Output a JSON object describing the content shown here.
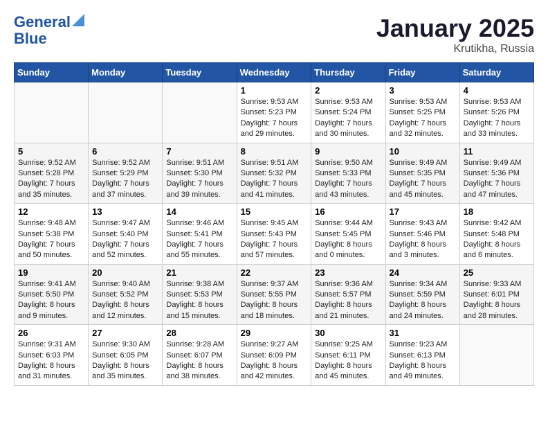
{
  "logo": {
    "line1": "General",
    "line2": "Blue"
  },
  "title": "January 2025",
  "location": "Krutikha, Russia",
  "days_header": [
    "Sunday",
    "Monday",
    "Tuesday",
    "Wednesday",
    "Thursday",
    "Friday",
    "Saturday"
  ],
  "weeks": [
    [
      {
        "day": "",
        "sunrise": "",
        "sunset": "",
        "daylight": ""
      },
      {
        "day": "",
        "sunrise": "",
        "sunset": "",
        "daylight": ""
      },
      {
        "day": "",
        "sunrise": "",
        "sunset": "",
        "daylight": ""
      },
      {
        "day": "1",
        "sunrise": "Sunrise: 9:53 AM",
        "sunset": "Sunset: 5:23 PM",
        "daylight": "Daylight: 7 hours and 29 minutes."
      },
      {
        "day": "2",
        "sunrise": "Sunrise: 9:53 AM",
        "sunset": "Sunset: 5:24 PM",
        "daylight": "Daylight: 7 hours and 30 minutes."
      },
      {
        "day": "3",
        "sunrise": "Sunrise: 9:53 AM",
        "sunset": "Sunset: 5:25 PM",
        "daylight": "Daylight: 7 hours and 32 minutes."
      },
      {
        "day": "4",
        "sunrise": "Sunrise: 9:53 AM",
        "sunset": "Sunset: 5:26 PM",
        "daylight": "Daylight: 7 hours and 33 minutes."
      }
    ],
    [
      {
        "day": "5",
        "sunrise": "Sunrise: 9:52 AM",
        "sunset": "Sunset: 5:28 PM",
        "daylight": "Daylight: 7 hours and 35 minutes."
      },
      {
        "day": "6",
        "sunrise": "Sunrise: 9:52 AM",
        "sunset": "Sunset: 5:29 PM",
        "daylight": "Daylight: 7 hours and 37 minutes."
      },
      {
        "day": "7",
        "sunrise": "Sunrise: 9:51 AM",
        "sunset": "Sunset: 5:30 PM",
        "daylight": "Daylight: 7 hours and 39 minutes."
      },
      {
        "day": "8",
        "sunrise": "Sunrise: 9:51 AM",
        "sunset": "Sunset: 5:32 PM",
        "daylight": "Daylight: 7 hours and 41 minutes."
      },
      {
        "day": "9",
        "sunrise": "Sunrise: 9:50 AM",
        "sunset": "Sunset: 5:33 PM",
        "daylight": "Daylight: 7 hours and 43 minutes."
      },
      {
        "day": "10",
        "sunrise": "Sunrise: 9:49 AM",
        "sunset": "Sunset: 5:35 PM",
        "daylight": "Daylight: 7 hours and 45 minutes."
      },
      {
        "day": "11",
        "sunrise": "Sunrise: 9:49 AM",
        "sunset": "Sunset: 5:36 PM",
        "daylight": "Daylight: 7 hours and 47 minutes."
      }
    ],
    [
      {
        "day": "12",
        "sunrise": "Sunrise: 9:48 AM",
        "sunset": "Sunset: 5:38 PM",
        "daylight": "Daylight: 7 hours and 50 minutes."
      },
      {
        "day": "13",
        "sunrise": "Sunrise: 9:47 AM",
        "sunset": "Sunset: 5:40 PM",
        "daylight": "Daylight: 7 hours and 52 minutes."
      },
      {
        "day": "14",
        "sunrise": "Sunrise: 9:46 AM",
        "sunset": "Sunset: 5:41 PM",
        "daylight": "Daylight: 7 hours and 55 minutes."
      },
      {
        "day": "15",
        "sunrise": "Sunrise: 9:45 AM",
        "sunset": "Sunset: 5:43 PM",
        "daylight": "Daylight: 7 hours and 57 minutes."
      },
      {
        "day": "16",
        "sunrise": "Sunrise: 9:44 AM",
        "sunset": "Sunset: 5:45 PM",
        "daylight": "Daylight: 8 hours and 0 minutes."
      },
      {
        "day": "17",
        "sunrise": "Sunrise: 9:43 AM",
        "sunset": "Sunset: 5:46 PM",
        "daylight": "Daylight: 8 hours and 3 minutes."
      },
      {
        "day": "18",
        "sunrise": "Sunrise: 9:42 AM",
        "sunset": "Sunset: 5:48 PM",
        "daylight": "Daylight: 8 hours and 6 minutes."
      }
    ],
    [
      {
        "day": "19",
        "sunrise": "Sunrise: 9:41 AM",
        "sunset": "Sunset: 5:50 PM",
        "daylight": "Daylight: 8 hours and 9 minutes."
      },
      {
        "day": "20",
        "sunrise": "Sunrise: 9:40 AM",
        "sunset": "Sunset: 5:52 PM",
        "daylight": "Daylight: 8 hours and 12 minutes."
      },
      {
        "day": "21",
        "sunrise": "Sunrise: 9:38 AM",
        "sunset": "Sunset: 5:53 PM",
        "daylight": "Daylight: 8 hours and 15 minutes."
      },
      {
        "day": "22",
        "sunrise": "Sunrise: 9:37 AM",
        "sunset": "Sunset: 5:55 PM",
        "daylight": "Daylight: 8 hours and 18 minutes."
      },
      {
        "day": "23",
        "sunrise": "Sunrise: 9:36 AM",
        "sunset": "Sunset: 5:57 PM",
        "daylight": "Daylight: 8 hours and 21 minutes."
      },
      {
        "day": "24",
        "sunrise": "Sunrise: 9:34 AM",
        "sunset": "Sunset: 5:59 PM",
        "daylight": "Daylight: 8 hours and 24 minutes."
      },
      {
        "day": "25",
        "sunrise": "Sunrise: 9:33 AM",
        "sunset": "Sunset: 6:01 PM",
        "daylight": "Daylight: 8 hours and 28 minutes."
      }
    ],
    [
      {
        "day": "26",
        "sunrise": "Sunrise: 9:31 AM",
        "sunset": "Sunset: 6:03 PM",
        "daylight": "Daylight: 8 hours and 31 minutes."
      },
      {
        "day": "27",
        "sunrise": "Sunrise: 9:30 AM",
        "sunset": "Sunset: 6:05 PM",
        "daylight": "Daylight: 8 hours and 35 minutes."
      },
      {
        "day": "28",
        "sunrise": "Sunrise: 9:28 AM",
        "sunset": "Sunset: 6:07 PM",
        "daylight": "Daylight: 8 hours and 38 minutes."
      },
      {
        "day": "29",
        "sunrise": "Sunrise: 9:27 AM",
        "sunset": "Sunset: 6:09 PM",
        "daylight": "Daylight: 8 hours and 42 minutes."
      },
      {
        "day": "30",
        "sunrise": "Sunrise: 9:25 AM",
        "sunset": "Sunset: 6:11 PM",
        "daylight": "Daylight: 8 hours and 45 minutes."
      },
      {
        "day": "31",
        "sunrise": "Sunrise: 9:23 AM",
        "sunset": "Sunset: 6:13 PM",
        "daylight": "Daylight: 8 hours and 49 minutes."
      },
      {
        "day": "",
        "sunrise": "",
        "sunset": "",
        "daylight": ""
      }
    ]
  ]
}
